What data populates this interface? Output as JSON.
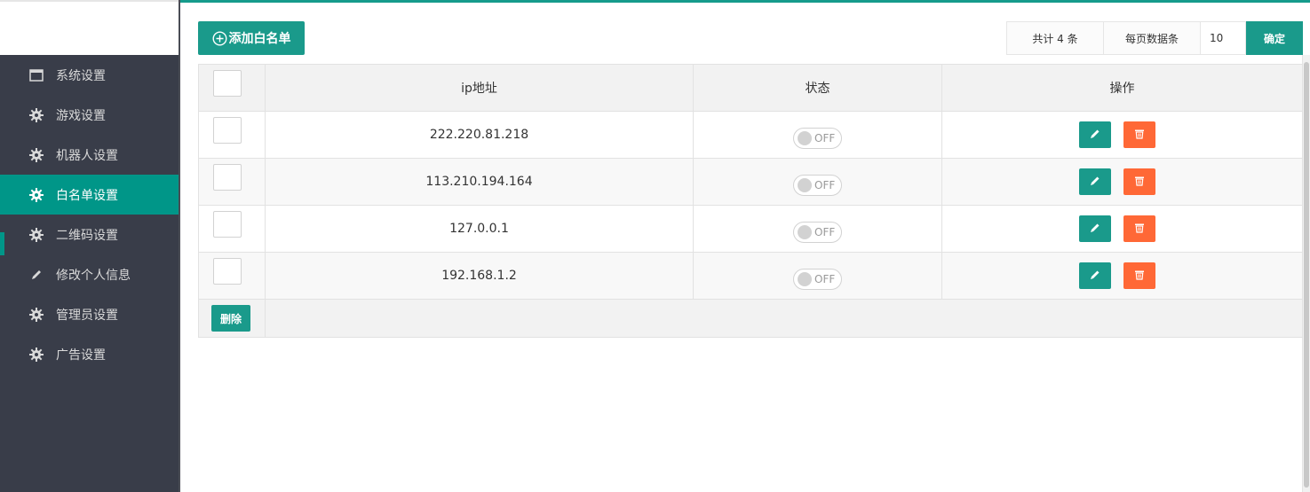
{
  "sidebar": {
    "active_index": 3,
    "items": [
      {
        "label": "系统设置",
        "icon": "window-icon"
      },
      {
        "label": "游戏设置",
        "icon": "gear-icon"
      },
      {
        "label": "机器人设置",
        "icon": "gear-icon"
      },
      {
        "label": "白名单设置",
        "icon": "gear-icon"
      },
      {
        "label": "二维码设置",
        "icon": "gear-icon"
      },
      {
        "label": "修改个人信息",
        "icon": "pencil-icon"
      },
      {
        "label": "管理员设置",
        "icon": "gear-icon"
      },
      {
        "label": "广告设置",
        "icon": "gear-icon"
      }
    ]
  },
  "toolbar": {
    "add_label": "添加白名单",
    "add_icon": "plus-circle-icon"
  },
  "pager": {
    "total_label": "共计 4 条",
    "per_page_label": "每页数据条",
    "per_page_value": "10",
    "confirm_label": "确定"
  },
  "table": {
    "columns": [
      "",
      "ip地址",
      "状态",
      "操作"
    ],
    "rows": [
      {
        "ip": "222.220.81.218",
        "status": "OFF"
      },
      {
        "ip": "113.210.194.164",
        "status": "OFF"
      },
      {
        "ip": "127.0.0.1",
        "status": "OFF"
      },
      {
        "ip": "192.168.1.2",
        "status": "OFF"
      }
    ],
    "row_actions": {
      "edit_icon": "pencil-icon",
      "delete_icon": "trash-icon"
    },
    "footer_delete_label": "删除"
  },
  "colors": {
    "accent": "#009688",
    "button": "#1a9a8b",
    "danger": "#ff6836",
    "sidebar_bg": "#393d49"
  }
}
